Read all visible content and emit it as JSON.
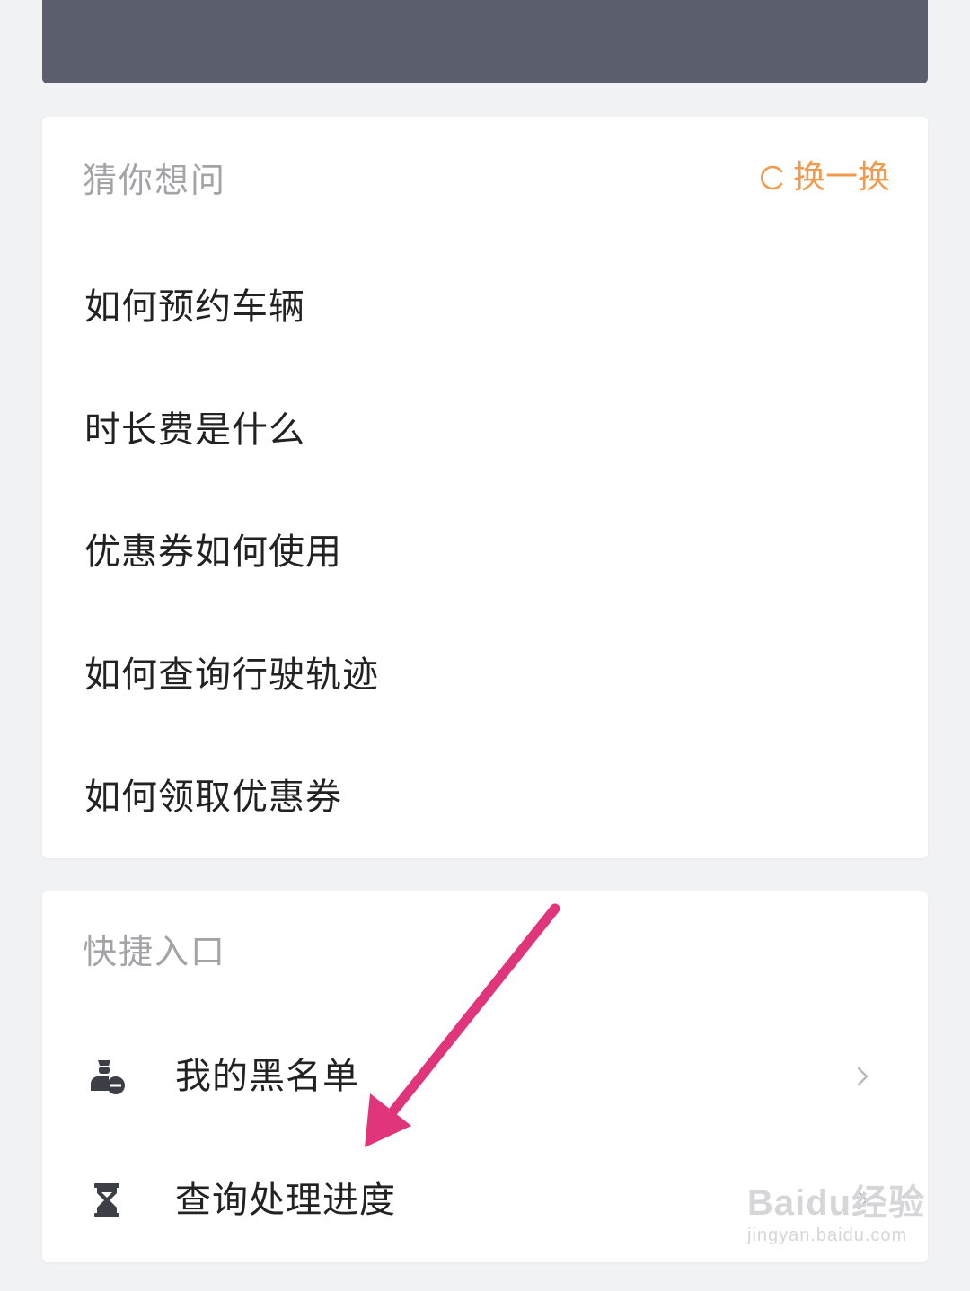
{
  "suggest": {
    "title": "猜你想问",
    "refresh_label": "换一换",
    "questions": [
      "如何预约车辆",
      "时长费是什么",
      "优惠券如何使用",
      "如何查询行驶轨迹",
      "如何领取优惠券"
    ]
  },
  "quick": {
    "title": "快捷入口",
    "items": [
      {
        "label": "我的黑名单",
        "icon": "user-blocked-icon"
      },
      {
        "label": "查询处理进度",
        "icon": "hourglass-icon"
      }
    ]
  },
  "colors": {
    "banner": "#5b5f6d",
    "accent": "#f29a4d",
    "annotation_arrow": "#e0357a"
  },
  "watermark": {
    "main": "Baidu经验",
    "sub": "jingyan.baidu.com"
  }
}
